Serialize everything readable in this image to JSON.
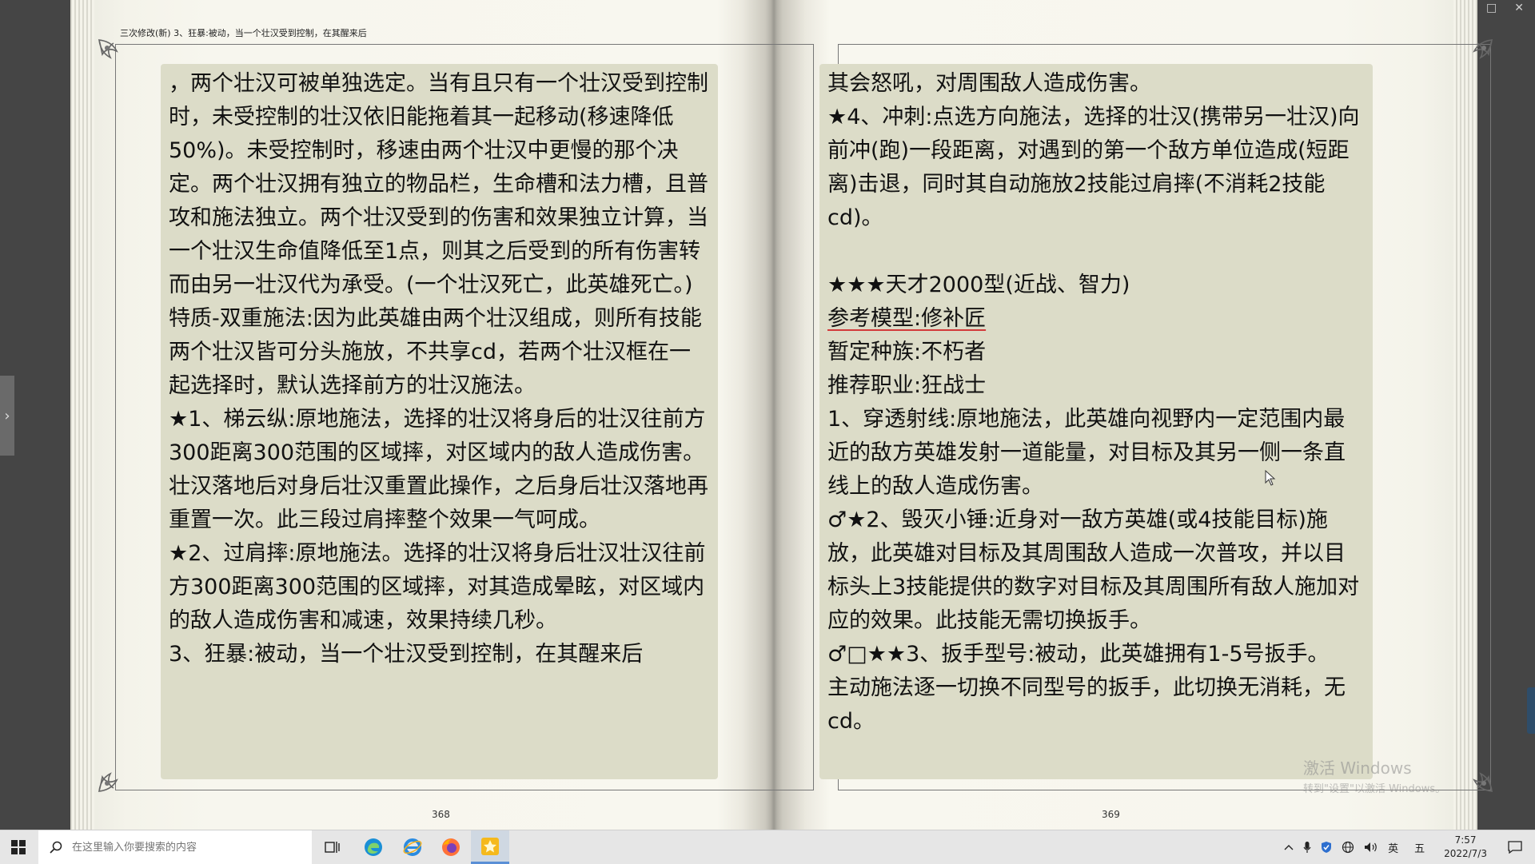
{
  "book": {
    "running_head": "三次修改(新) 3、狂暴:被动，当一个壮汉受到控制，在其醒来后",
    "left_page": {
      "page_number": "368",
      "paragraphs": [
        "，两个壮汉可被单独选定。当有且只有一个壮汉受到控制时，未受控制的壮汉依旧能拖着其一起移动(移速降低50%)。未受控制时，移速由两个壮汉中更慢的那个决定。两个壮汉拥有独立的物品栏，生命槽和法力槽，且普攻和施法独立。两个壮汉受到的伤害和效果独立计算，当一个壮汉生命值降低至1点，则其之后受到的所有伤害转而由另一壮汉代为承受。(一个壮汉死亡，此英雄死亡。)",
        "特质-双重施法:因为此英雄由两个壮汉组成，则所有技能两个壮汉皆可分头施放，不共享cd，若两个壮汉框在一起选择时，默认选择前方的壮汉施法。",
        "★1、梯云纵:原地施法，选择的壮汉将身后的壮汉往前方300距离300范围的区域摔，对区域内的敌人造成伤害。壮汉落地后对身后壮汉重置此操作，之后身后壮汉落地再重置一次。此三段过肩摔整个效果一气呵成。",
        "★2、过肩摔:原地施法。选择的壮汉将身后壮汉壮汉往前方300距离300范围的区域摔，对其造成晕眩，对区域内的敌人造成伤害和减速，效果持续几秒。",
        "3、狂暴:被动，当一个壮汉受到控制，在其醒来后"
      ]
    },
    "right_page": {
      "page_number": "369",
      "paragraphs": [
        "其会怒吼，对周围敌人造成伤害。",
        "★4、冲刺:点选方向施法，选择的壮汉(携带另一壮汉)向前冲(跑)一段距离，对遇到的第一个敌方单位造成(短距离)击退，同时其自动施放2技能过肩摔(不消耗2技能cd)。",
        " ",
        "★★★天才2000型(近战、智力)",
        "参考模型:修补匠",
        "暂定种族:不朽者",
        "推荐职业:狂战士",
        "1、穿透射线:原地施法，此英雄向视野内一定范围内最近的敌方英雄发射一道能量，对目标及其另一侧一条直线上的敌人造成伤害。",
        "♂★2、毁灭小锤:近身对一敌方英雄(或4技能目标)施放，此英雄对目标及其周围敌人造成一次普攻，并以目标头上3技能提供的数字对目标及其周围所有敌人施加对应的效果。此技能无需切换扳手。",
        "♂□★★3、扳手型号:被动，此英雄拥有1-5号扳手。",
        "主动施法逐一切换不同型号的扳手，此切换无消耗，无cd。"
      ]
    },
    "watermark": {
      "line1": "激活 Windows",
      "line2": "转到\"设置\"以激活 Windows。"
    }
  },
  "taskbar": {
    "search_placeholder": "在这里输入你要搜索的内容",
    "ime_lang": "英",
    "ime_mode": "五",
    "time": "7:57",
    "date": "2022/7/3"
  },
  "icons": {
    "start": "windows-logo-icon",
    "search": "search-icon",
    "task_view": "task-view-icon",
    "edge": "edge-browser-icon",
    "ie": "ie-browser-icon",
    "firefox": "firefox-icon",
    "reader_app": "reader-app-icon",
    "tray_chevron": "chevron-up-icon",
    "mic": "microphone-icon",
    "shield": "shield-icon",
    "network": "network-icon",
    "volume": "volume-icon",
    "notifications": "notification-icon"
  },
  "colors": {
    "text_block_bg": "#dcdcc8",
    "page_bg": "#f8f7ef",
    "reader_bg": "#454545",
    "taskbar_bg": "#e6e6e6",
    "active_app_underline": "#5a8fd6"
  }
}
